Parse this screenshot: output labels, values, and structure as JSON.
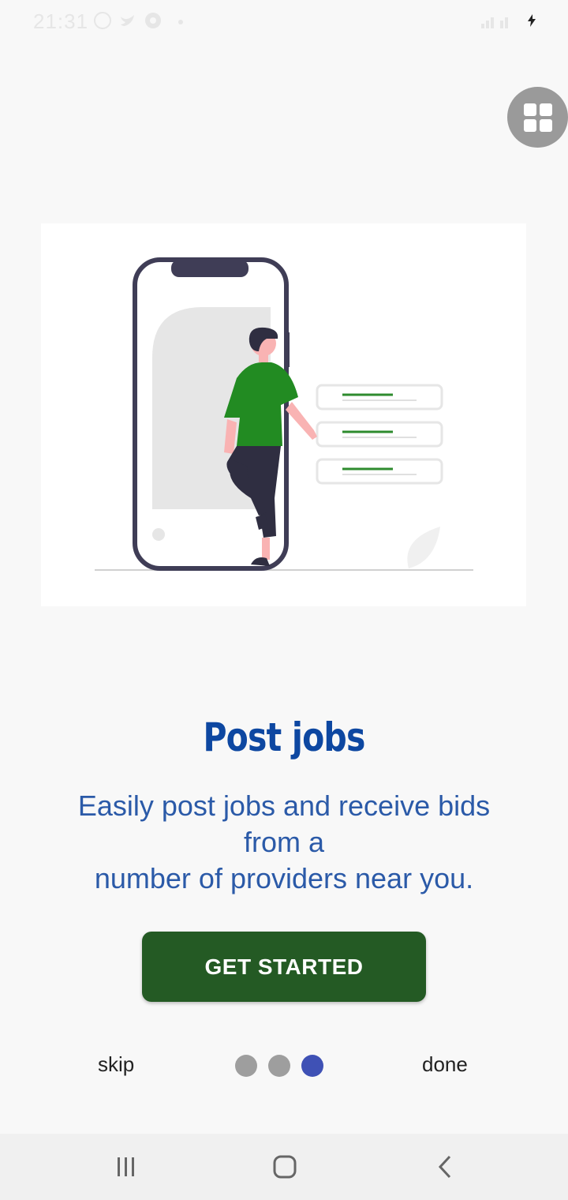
{
  "status_bar": {
    "time": "21:31",
    "icons": [
      "whatsapp-icon",
      "twitter-icon",
      "chrome-icon"
    ]
  },
  "illustration": {
    "description_icon": "person-with-phone-illustration"
  },
  "onboarding": {
    "title": "Post jobs",
    "description_line1": "Easily post jobs and receive bids",
    "description_line2": "from a",
    "description_line3": "number of providers near you."
  },
  "actions": {
    "get_started_label": "GET STARTED",
    "skip_label": "skip",
    "done_label": "done"
  },
  "pager": {
    "page_count": 3,
    "current_page": 3
  },
  "colors": {
    "title": "#0d47a1",
    "description": "#2b5aa8",
    "button": "#245a24",
    "active_dot": "#3f51b5",
    "inactive_dot": "#9e9e9e"
  }
}
